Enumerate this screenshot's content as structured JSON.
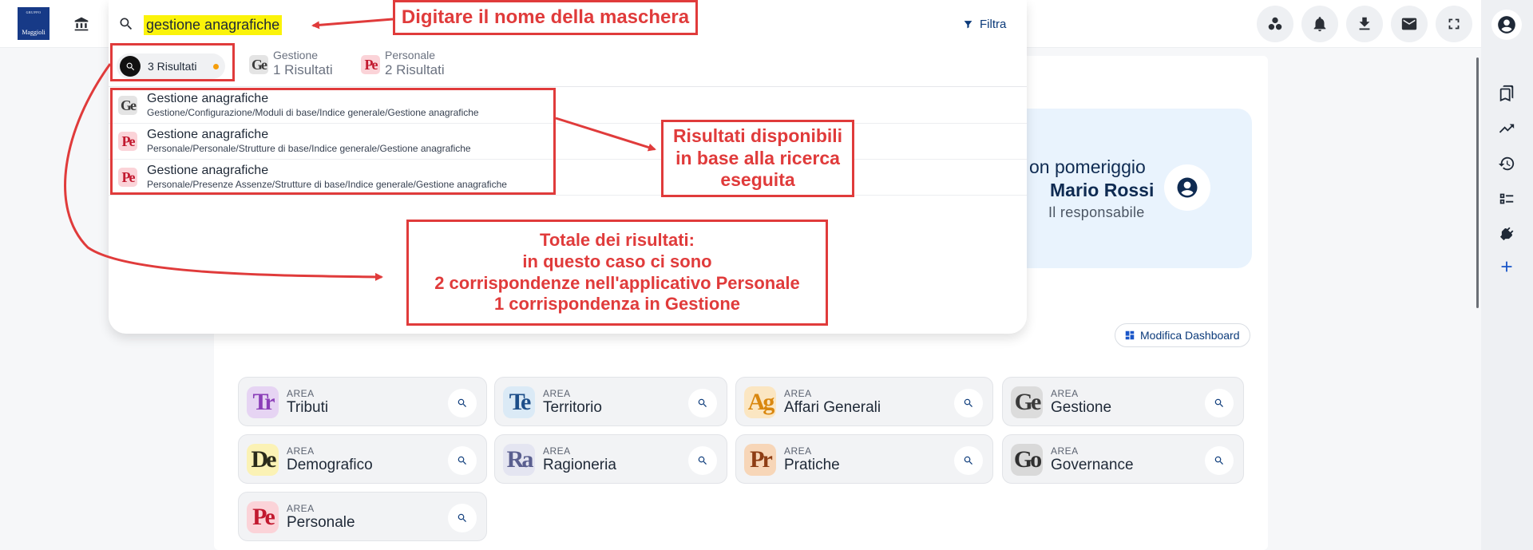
{
  "header": {
    "logo_top": "GRUPPO",
    "logo_name": "Maggioli",
    "filter_label": "Filtra"
  },
  "search": {
    "value": "gestione anagrafiche"
  },
  "tabs": {
    "all_label": "3 Risultati",
    "apps": [
      {
        "abbr": "Ge",
        "name": "Gestione",
        "count": "1 Risultati"
      },
      {
        "abbr": "Pe",
        "name": "Personale",
        "count": "2 Risultati"
      }
    ]
  },
  "results": [
    {
      "abbr": "Ge",
      "title": "Gestione anagrafiche",
      "path": "Gestione/Configurazione/Moduli di base/Indice generale/Gestione anagrafiche"
    },
    {
      "abbr": "Pe",
      "title": "Gestione anagrafiche",
      "path": "Personale/Personale/Strutture di base/Indice generale/Gestione anagrafiche"
    },
    {
      "abbr": "Pe",
      "title": "Gestione anagrafiche",
      "path": "Personale/Presenze Assenze/Strutture di base/Indice generale/Gestione anagrafiche"
    }
  ],
  "greeting": {
    "line1": "on pomeriggio",
    "name": "Mario Rossi",
    "role": "Il responsabile"
  },
  "dashboard_button": "Modifica Dashboard",
  "areas": [
    {
      "abbr": "Tr",
      "prefix": "AREA",
      "name": "Tributi",
      "bg": "#e6d4f3",
      "fg": "#8b3fb8"
    },
    {
      "abbr": "Te",
      "prefix": "AREA",
      "name": "Territorio",
      "bg": "#dbeaf6",
      "fg": "#1d4e89"
    },
    {
      "abbr": "Ag",
      "prefix": "AREA",
      "name": "Affari Generali",
      "bg": "#fbe6c2",
      "fg": "#d9870f"
    },
    {
      "abbr": "Ge",
      "prefix": "AREA",
      "name": "Gestione",
      "bg": "#dcdcdc",
      "fg": "#3a3a3a"
    },
    {
      "abbr": "De",
      "prefix": "AREA",
      "name": "Demografico",
      "bg": "#fbf2b5",
      "fg": "#2a2a1a"
    },
    {
      "abbr": "Ra",
      "prefix": "AREA",
      "name": "Ragioneria",
      "bg": "#e4e5f1",
      "fg": "#5a5f8f"
    },
    {
      "abbr": "Pr",
      "prefix": "AREA",
      "name": "Pratiche",
      "bg": "#f7d6b8",
      "fg": "#8e3d14"
    },
    {
      "abbr": "Go",
      "prefix": "AREA",
      "name": "Governance",
      "bg": "#d9d9d9",
      "fg": "#2f2f2f"
    },
    {
      "abbr": "Pe",
      "prefix": "AREA",
      "name": "Personale",
      "bg": "#fbd3d8",
      "fg": "#c2192f"
    }
  ],
  "annotations": {
    "top": "Digitare il nome della maschera",
    "right_lines": [
      "Risultati disponibili",
      "in base alla ricerca",
      "eseguita"
    ],
    "bottom_lines": [
      "Totale dei risultati:",
      "in questo caso ci sono",
      "2 corrispondenze nell'applicativo Personale",
      "1 corrispondenza in Gestione"
    ]
  },
  "colors": {
    "annotation": "#e03b3b",
    "highlight": "#fbf30a",
    "brand": "#173a87"
  }
}
